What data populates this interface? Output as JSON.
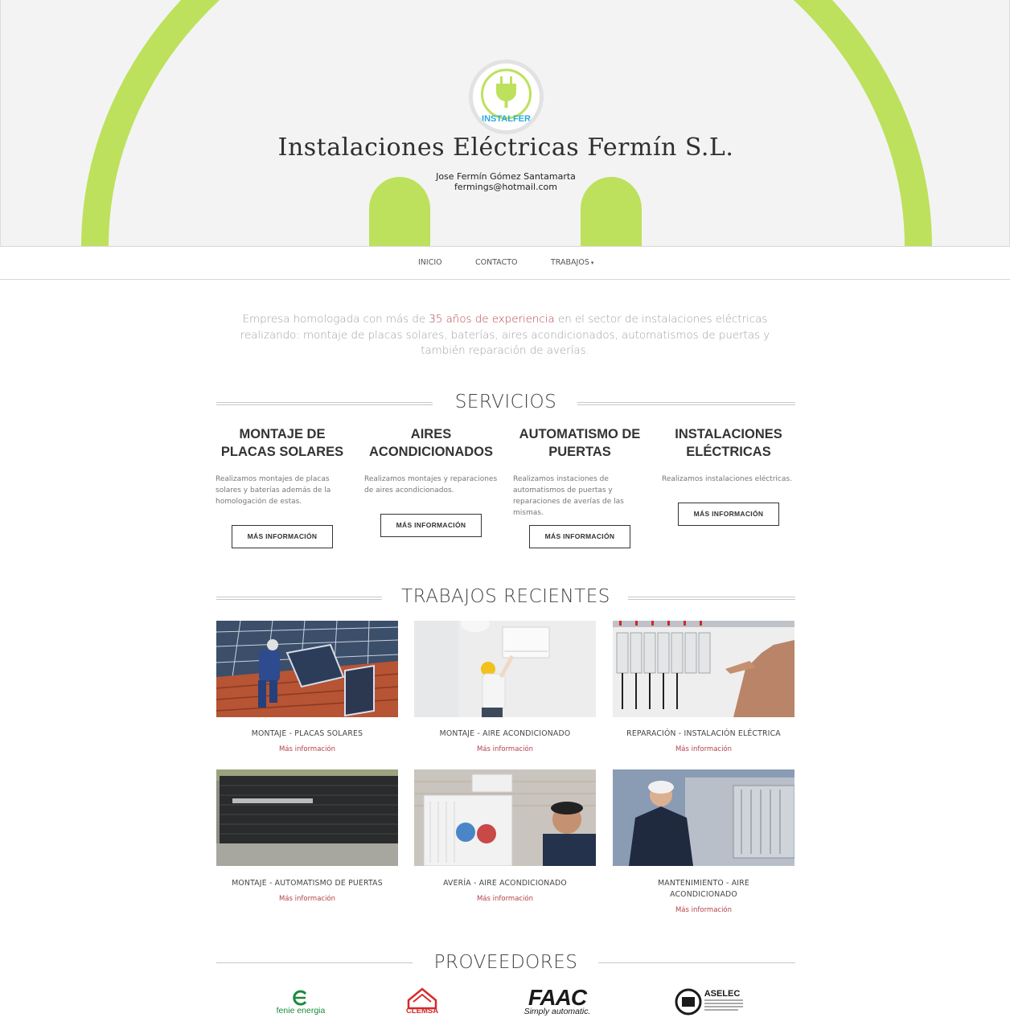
{
  "header": {
    "logo_text": "INSTALFER",
    "title": "Instalaciones Eléctricas Fermín S.L.",
    "owner": "Jose Fermín Gómez Santamarta",
    "email": "fermings@hotmail.com"
  },
  "nav": {
    "items": [
      {
        "label": "INICIO"
      },
      {
        "label": "CONTACTO"
      },
      {
        "label": "TRABAJOS"
      }
    ]
  },
  "intro": {
    "before": "Empresa homologada con más de ",
    "highlight": "35 años de experiencia",
    "after": " en el sector de instalaciones eléctricas realizando: montaje de placas solares, baterías, aires acondicionados, automatismos de puertas y también reparación de averías."
  },
  "services": {
    "heading": "SERVICIOS",
    "items": [
      {
        "title_1": "MONTAJE DE",
        "title_2": "PLACAS SOLARES",
        "desc": "Realizamos montajes de placas solares y baterías además de la homologación de estas.",
        "button": "MÁS INFORMACIÓN"
      },
      {
        "title_1": "AIRES",
        "title_2": "ACONDICIONADOS",
        "desc": "Realizamos montajes y reparaciones de aires acondicionados.",
        "button": "MÁS INFORMACIÓN"
      },
      {
        "title_1": "AUTOMATISMO DE",
        "title_2": "PUERTAS",
        "desc": "Realizamos instaciones de automatismos de puertas y reparaciones de averías de las mismas.",
        "button": "MÁS INFORMACIÓN"
      },
      {
        "title_1": "INSTALACIONES",
        "title_2": "ELÉCTRICAS",
        "desc": "Realizamos instalaciones eléctricas.",
        "button": "MÁS INFORMACIÓN"
      }
    ]
  },
  "works": {
    "heading": "TRABAJOS RECIENTES",
    "items": [
      {
        "title": "MONTAJE - PLACAS SOLARES",
        "link": "Más información"
      },
      {
        "title": "MONTAJE - AIRE ACONDICIONADO",
        "link": "Más información"
      },
      {
        "title": "REPARACIÓN - INSTALACIÓN ELÉCTRICA",
        "link": "Más información"
      },
      {
        "title": "MONTAJE - AUTOMATISMO DE PUERTAS",
        "link": "Más información"
      },
      {
        "title": "AVERÍA - AIRE ACONDICIONADO",
        "link": "Más información"
      },
      {
        "title_1": "MANTENIMIENTO - AIRE",
        "title_2": "ACONDICIONADO",
        "link": "Más información"
      }
    ]
  },
  "providers": {
    "heading": "PROVEEDORES",
    "items": [
      {
        "name": "fenie energia"
      },
      {
        "name": "CLEMSA"
      },
      {
        "name": "FAAC",
        "tagline": "Simply automatic."
      },
      {
        "name": "ASELEC"
      }
    ]
  },
  "colors": {
    "accent_green": "#bde15c",
    "link_red": "#b3424a",
    "logo_blue": "#29a9e0"
  }
}
